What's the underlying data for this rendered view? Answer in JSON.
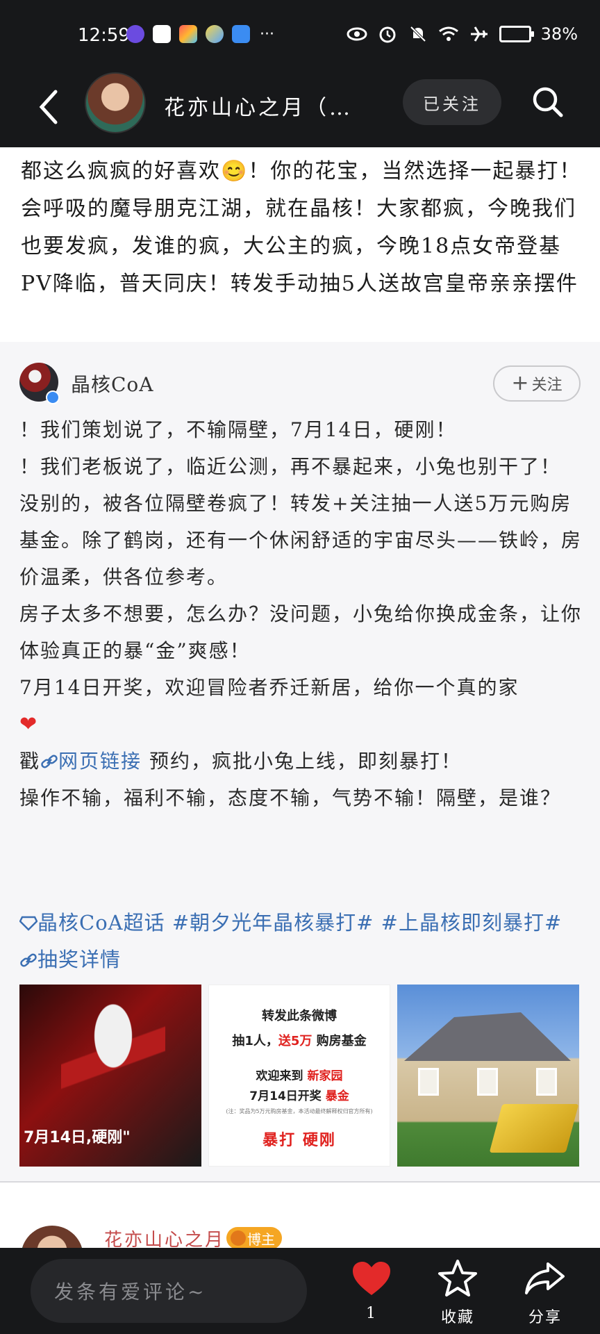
{
  "status_bar": {
    "time": "12:59",
    "battery": "38%",
    "icons": [
      "notification-app-icon",
      "calendar-icon",
      "app-icon",
      "weather-icon",
      "browser-icon",
      "more-dots",
      "eye-icon",
      "alarm-icon",
      "mute-icon",
      "wifi-icon",
      "airplane-icon",
      "battery-icon"
    ],
    "more": "···"
  },
  "nav": {
    "title": "花亦山心之月（…",
    "follow_state": "已关注"
  },
  "post": {
    "text": "都这么疯疯的好喜欢😊！你的花宝，当然选择一起暴打！会呼吸的魔导朋克江湖，就在晶核！大家都疯，今晚我们也要发疯，发谁的疯，大公主的疯，今晚18点女帝登基PV降临，普天同庆！转发手动抽5人送故宫皇帝亲亲摆件"
  },
  "repost": {
    "author": "晶核CoA",
    "follow_label": "关注",
    "lines": [
      "！我们策划说了，不输隔壁，7月14日，硬刚！",
      "！我们老板说了，临近公测，再不暴起来，小兔也别干了！",
      "没别的，被各位隔壁卷疯了！转发+关注抽一人送5万元购房基金。除了鹤岗，还有一个休闲舒适的宇宙尽头——铁岭，房价温柔，供各位参考。",
      "房子太多不想要，怎么办？没问题，小兔给你换成金条，让你体验真正的暴“金”爽感！",
      "7月14日开奖，欢迎冒险者乔迁新居，给你一个真的家",
      "❤",
      "预约，疯批小兔上线，即刻暴打！",
      "操作不输，福利不输，态度不输，气势不输！隔壁，是谁？"
    ],
    "line6_prefix": "戳",
    "link_text": "网页链接",
    "tags": {
      "super_topic": "晶核CoA超话",
      "hashtag1": "#朝夕光年晶核暴打#",
      "hashtag2": "#上晶核即刻暴打#",
      "lottery": "抽奖详情"
    },
    "thumbnails": {
      "thumb1_caption": "7月14日,硬刚\"",
      "thumb2": {
        "line1": "转发此条微博",
        "line2_a": "抽1人，",
        "line2_b": "送5万",
        "line2_c": "购房基金",
        "line3_a": "欢迎来到",
        "line3_b": "新家园",
        "line4_a": "7月14日开奖",
        "line4_b": "暴金",
        "small": "(注：奖品为5万元购房基金，本活动最终解释权归官方所有)",
        "line6": "暴打 硬刚"
      }
    }
  },
  "comment_preview": {
    "name": "花亦山心之月",
    "badge": "博主"
  },
  "bottom_bar": {
    "placeholder": "发条有爱评论~",
    "like_count": "1",
    "favorite_label": "收藏",
    "share_label": "分享"
  },
  "colors": {
    "dark_bar": "#17181a",
    "link_blue": "#3b6fb3",
    "heart_red": "#e32a2a",
    "comment_name": "#c44b4b",
    "owner_badge": "#f5a623"
  }
}
